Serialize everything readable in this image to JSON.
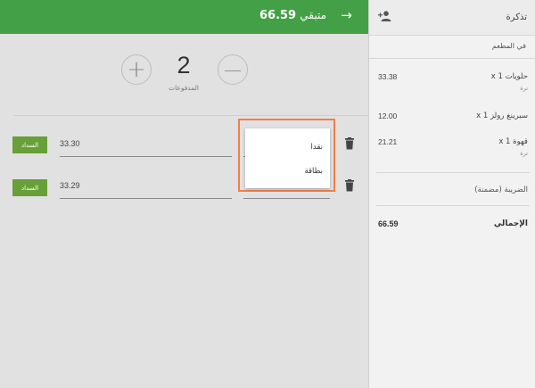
{
  "topbar": {
    "remaining_label": "متبقي",
    "remaining_amount": "66.59",
    "arrow_icon": "arrow-right-icon"
  },
  "counter": {
    "count": "2",
    "label": "المدفوعات",
    "plus": "+",
    "minus": "—"
  },
  "payments": [
    {
      "pay_label": "السداد",
      "amount": "33.30"
    },
    {
      "pay_label": "السداد",
      "amount": "33.29"
    }
  ],
  "dropdown": {
    "options": [
      "نقدا",
      "بطاقة"
    ]
  },
  "ticket": {
    "title": "تذكرة",
    "venue": "في المطعم",
    "items": [
      {
        "name": "حلويات x 1",
        "price": "33.38",
        "note": "ترة"
      },
      {
        "name": "سبرينغ رولز x 1",
        "price": "12.00",
        "note": ""
      },
      {
        "name": "قهوة x 1",
        "price": "21.21",
        "note": "ترة"
      }
    ],
    "tax_label": "الضريبة (مضمنة)",
    "total_label": "الإجمالي",
    "total_value": "66.59"
  },
  "colors": {
    "header_green": "#43a047",
    "pay_button_green": "#689f38",
    "highlight_orange": "#f47c4a"
  }
}
